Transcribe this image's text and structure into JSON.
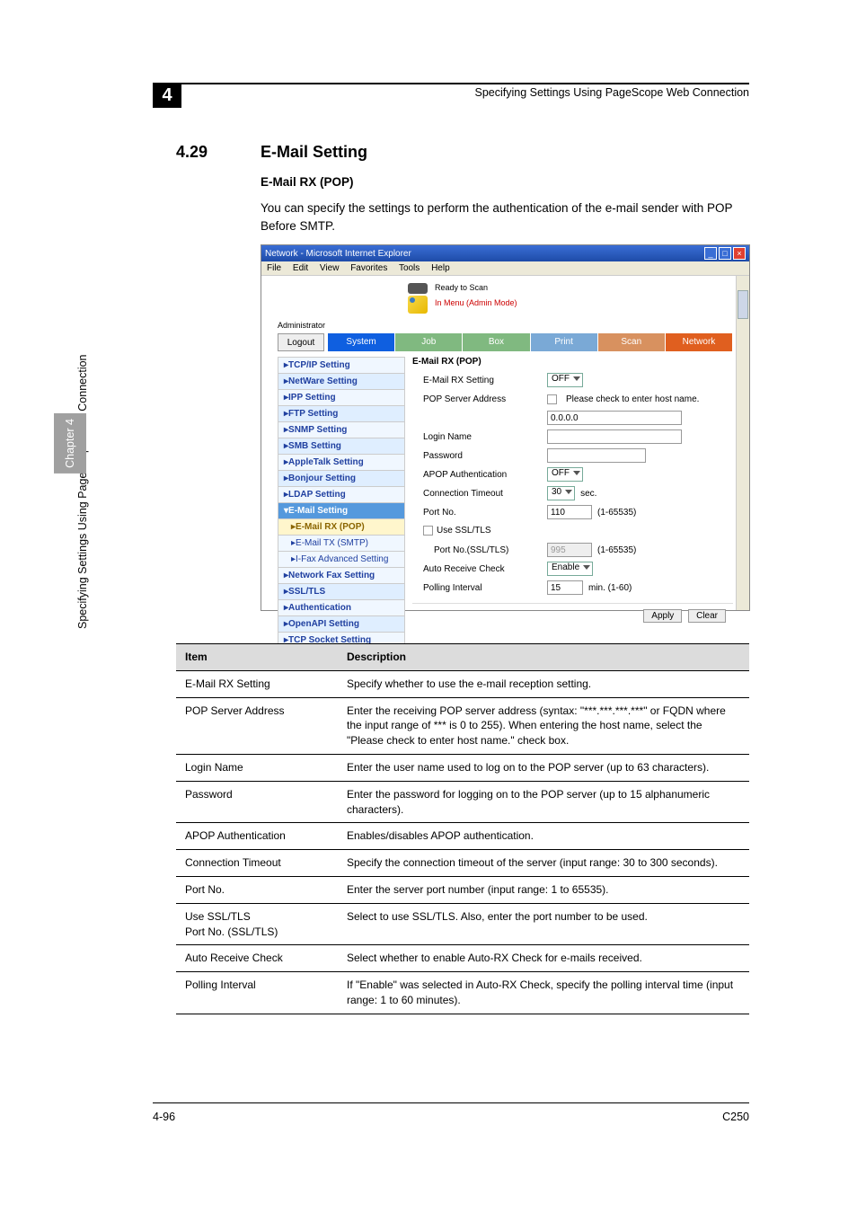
{
  "header": "Specifying Settings Using PageScope Web Connection",
  "chapter_num": "4",
  "section_num": "4.29",
  "section_title": "E-Mail Setting",
  "sub_title": "E-Mail RX (POP)",
  "body": "You can specify the settings to perform the authentication of the e-mail sender with POP Before SMTP.",
  "side_text": "Specifying Settings Using PageScope Web Connection",
  "side_chapter": "Chapter 4",
  "footer_left": "4-96",
  "footer_right": "C250",
  "win": {
    "title": "Network - Microsoft Internet Explorer",
    "menus": [
      "File",
      "Edit",
      "View",
      "Favorites",
      "Tools",
      "Help"
    ],
    "status": "Ready to Scan",
    "mode": "In Menu (Admin Mode)",
    "admin": "Administrator",
    "tabs": {
      "logout": "Logout",
      "system": "System",
      "job": "Job",
      "box": "Box",
      "print": "Print",
      "scan": "Scan",
      "network": "Network"
    },
    "sidebar": [
      "TCP/IP Setting",
      "NetWare Setting",
      "IPP Setting",
      "FTP Setting",
      "SNMP Setting",
      "SMB Setting",
      "AppleTalk Setting",
      "Bonjour Setting",
      "LDAP Setting",
      "E-Mail Setting",
      "E-Mail RX (POP)",
      "E-Mail TX (SMTP)",
      "I-Fax Advanced Setting",
      "Network Fax Setting",
      "SSL/TLS",
      "Authentication",
      "OpenAPI Setting",
      "TCP Socket Setting"
    ],
    "form": {
      "title": "E-Mail RX (POP)",
      "rx_label": "E-Mail RX Setting",
      "rx_val": "OFF",
      "pop_label": "POP Server Address",
      "pop_check": "Please check to enter host name.",
      "pop_val": "0.0.0.0",
      "login_label": "Login Name",
      "pw_label": "Password",
      "apop_label": "APOP Authentication",
      "apop_val": "OFF",
      "ct_label": "Connection Timeout",
      "ct_val": "30",
      "ct_unit": "sec.",
      "port_label": "Port No.",
      "port_val": "110",
      "port_range": "(1-65535)",
      "ssl_label": "Use SSL/TLS",
      "sslport_label": "Port No.(SSL/TLS)",
      "sslport_val": "995",
      "sslport_range": "(1-65535)",
      "auto_label": "Auto Receive Check",
      "auto_val": "Enable",
      "poll_label": "Polling Interval",
      "poll_val": "15",
      "poll_unit": "min. (1-60)",
      "apply": "Apply",
      "clear": "Clear"
    }
  },
  "table": {
    "h1": "Item",
    "h2": "Description",
    "rows": [
      {
        "i": "E-Mail RX Setting",
        "d": "Specify whether to use the e-mail reception setting."
      },
      {
        "i": "POP Server Address",
        "d": "Enter the receiving POP server address (syntax: \"***.***.***.***\" or FQDN where the input range of *** is 0 to 255). When entering the host name, select the \"Please check to enter host name.\" check box."
      },
      {
        "i": "Login Name",
        "d": "Enter the user name used to log on to the POP server (up to 63 characters)."
      },
      {
        "i": "Password",
        "d": "Enter the password for logging on to the POP server (up to 15 alphanumeric characters)."
      },
      {
        "i": "APOP Authentication",
        "d": "Enables/disables APOP authentication."
      },
      {
        "i": "Connection Timeout",
        "d": "Specify the connection timeout of the server (input range: 30 to 300 seconds)."
      },
      {
        "i": "Port No.",
        "d": "Enter the server port number (input range: 1 to 65535)."
      },
      {
        "i": "Use SSL/TLS\nPort No. (SSL/TLS)",
        "d": "Select to use SSL/TLS. Also, enter the port number to be used."
      },
      {
        "i": "Auto Receive Check",
        "d": "Select whether to enable Auto-RX Check for e-mails received."
      },
      {
        "i": "Polling Interval",
        "d": "If \"Enable\" was selected in Auto-RX Check, specify the polling interval time (input range: 1 to 60 minutes)."
      }
    ]
  }
}
